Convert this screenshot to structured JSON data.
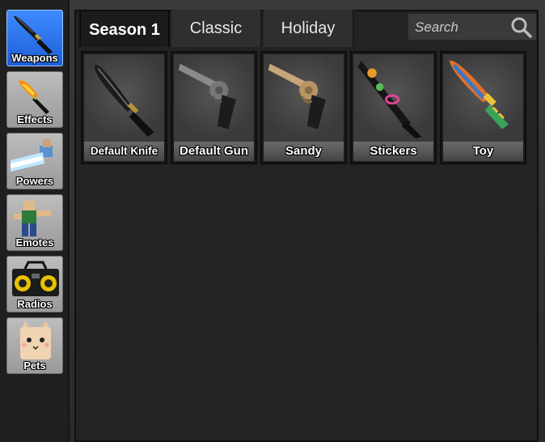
{
  "sidebar": {
    "items": [
      {
        "label": "Weapons",
        "icon": "knife-icon",
        "active": true
      },
      {
        "label": "Effects",
        "icon": "flame-knife-icon",
        "active": false
      },
      {
        "label": "Powers",
        "icon": "power-blast-icon",
        "active": false
      },
      {
        "label": "Emotes",
        "icon": "dancing-avatar-icon",
        "active": false
      },
      {
        "label": "Radios",
        "icon": "boombox-icon",
        "active": false
      },
      {
        "label": "Pets",
        "icon": "cat-icon",
        "active": false
      }
    ]
  },
  "tabs": [
    {
      "label": "Season 1",
      "active": true
    },
    {
      "label": "Classic",
      "active": false
    },
    {
      "label": "Holiday",
      "active": false
    }
  ],
  "search": {
    "placeholder": "Search",
    "value": ""
  },
  "items": [
    {
      "name": "Default Knife",
      "icon": "knife-icon"
    },
    {
      "name": "Default Gun",
      "icon": "revolver-icon"
    },
    {
      "name": "Sandy",
      "icon": "gold-revolver-icon"
    },
    {
      "name": "Stickers",
      "icon": "sticker-knife-icon"
    },
    {
      "name": "Toy",
      "icon": "toy-knife-icon"
    }
  ],
  "colors": {
    "accent": "#2f7bf0",
    "panel": "#232323",
    "tile_label": "#5a5a5a"
  }
}
